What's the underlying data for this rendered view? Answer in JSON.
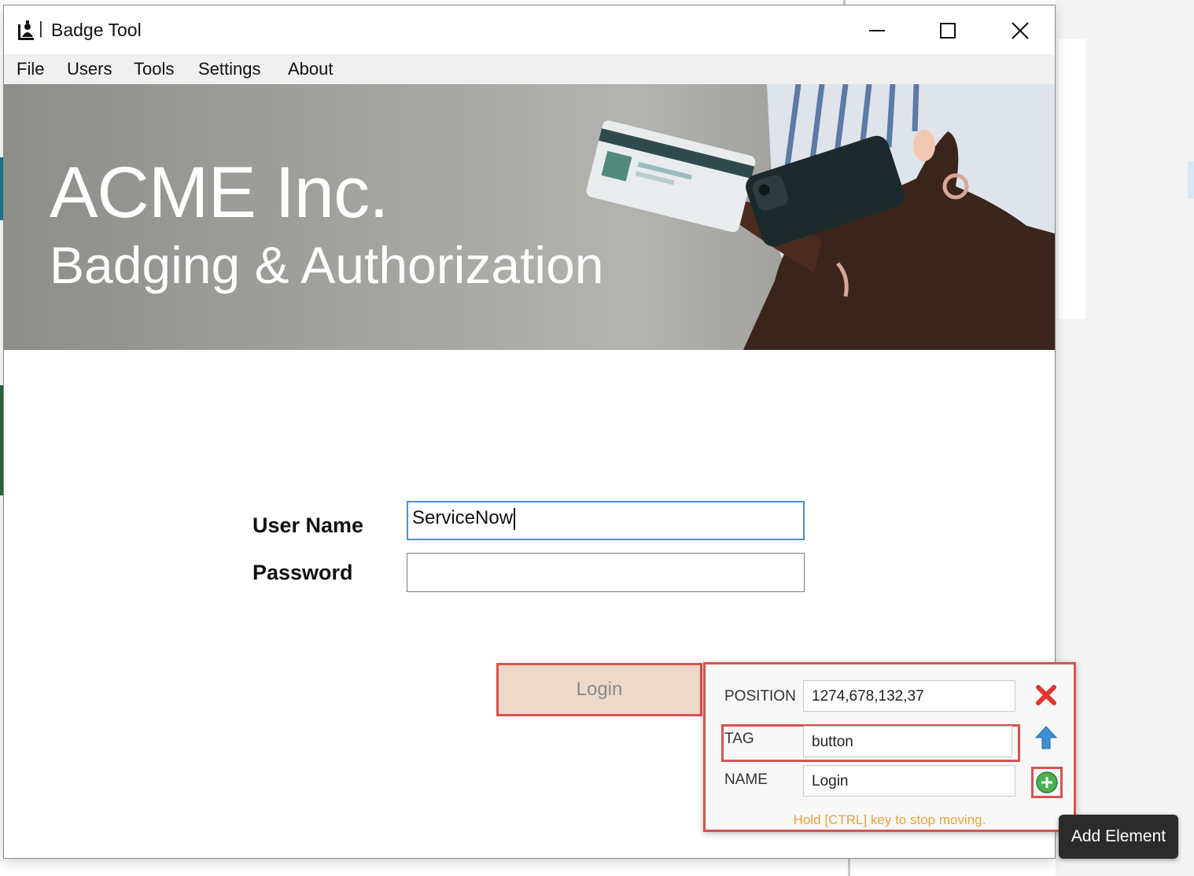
{
  "window": {
    "title": "Badge Tool",
    "title_separator": "|"
  },
  "menu": [
    "File",
    "Users",
    "Tools",
    "Settings",
    "About"
  ],
  "banner": {
    "title": "ACME Inc.",
    "subtitle": "Badging & Authorization"
  },
  "form": {
    "username_label": "User Name",
    "username_value": "ServiceNow",
    "password_label": "Password",
    "password_value": "",
    "login_label": "Login"
  },
  "inspector": {
    "position_label": "POSITION",
    "position_value": "1274,678,132,37",
    "tag_label": "TAG",
    "tag_value": "button",
    "name_label": "NAME",
    "name_value": "Login",
    "hint": "Hold [CTRL] key to stop moving.",
    "icons": [
      "close-x-icon",
      "arrow-up-icon",
      "add-circle-icon"
    ]
  },
  "tooltip": "Add Element",
  "colors": {
    "highlight": "#d9534f",
    "focus": "#4a90d9",
    "hint": "#e8a23c",
    "login_bg": "#eed9c9"
  }
}
